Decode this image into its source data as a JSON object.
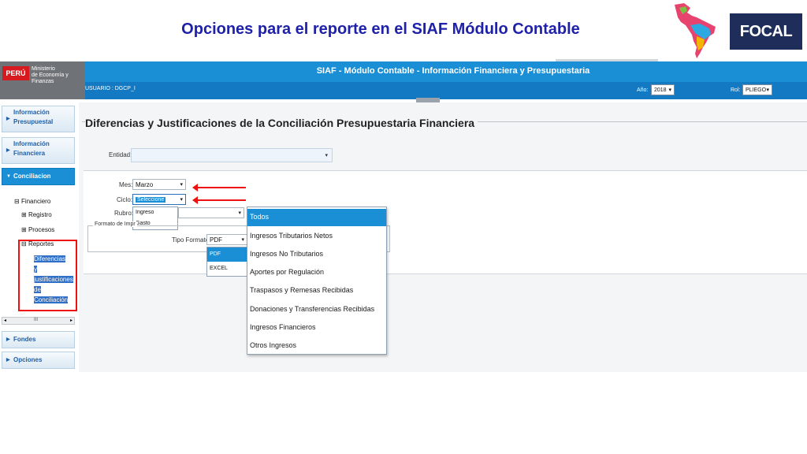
{
  "slide": {
    "title": "Opciones para el reporte en el SIAF Módulo Contable",
    "logo_text": "FOCAL"
  },
  "app": {
    "title": "SIAF - Módulo Contable - Información Financiera y Presupuestaria",
    "ministry_flag": "PERÚ",
    "ministry_name_line1": "Ministerio",
    "ministry_name_line2": "de Economía y Finanzas",
    "user": "USUARIO : DGCP_I",
    "year_label": "Año:",
    "year_value": "2018",
    "rol_label": "Rol:",
    "rol_value": "PLIEGO"
  },
  "sidebar": {
    "info_presupuestal": "Información Presupuestal",
    "info_financiera": "Información Financiera",
    "conciliacion": "Conciliacion",
    "fondos": "Fondes",
    "opciones": "Opciones",
    "tree": {
      "financiero": "Financiero",
      "registro": "Registro",
      "procesos": "Procesos",
      "reportes": "Reportes",
      "report_line1": "Diferencias",
      "report_line2": "y",
      "report_line3": "justificaciones",
      "report_line4": "de",
      "report_line5": "Conciliación"
    },
    "scroll_grip": "III"
  },
  "panel": {
    "title": "Diferencias y Justificaciones de la Conciliación Presupuestaria Financiera",
    "entidad_label": "Entidad:",
    "mes_label": "Mes:",
    "mes_value": "Marzo",
    "ciclo_label": "Ciclo:",
    "ciclo_value": "Seleccione",
    "ciclo_options": [
      "Ingreso",
      "Gasto"
    ],
    "rubro_label": "Rubro:",
    "formato_legend": "Formato de Impr",
    "tipo_formato_label": "Tipo Formato:",
    "tipo_formato_value": "PDF",
    "tipo_formato_options": [
      "PDF",
      "EXCEL"
    ],
    "rubro_options": [
      "Todos",
      "Ingresos Tributarios Netos",
      "Ingresos No Tributarios",
      "Aportes por Regulación",
      "Traspasos y Remesas Recibidas",
      "Donaciones y Transferencias Recibidas",
      "Ingresos Financieros",
      "Otros Ingresos"
    ]
  },
  "colors": {
    "header_blue": "#1a8fd6",
    "title_blue": "#1f22a8",
    "highlight_red": "#e11111"
  }
}
